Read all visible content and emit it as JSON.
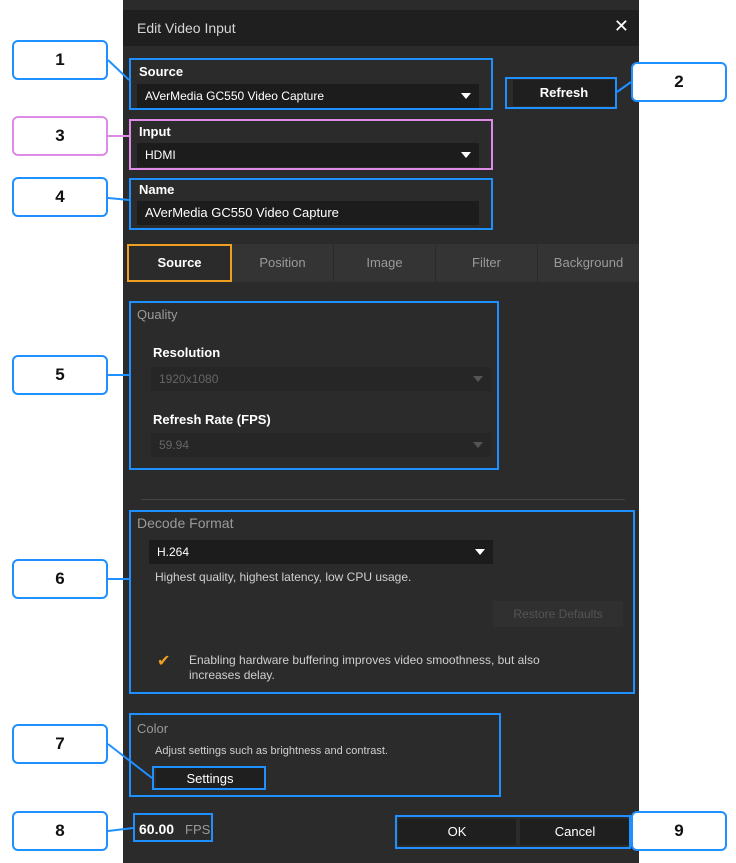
{
  "dialog": {
    "title": "Edit Video Input",
    "close_icon": "✕"
  },
  "source": {
    "label": "Source",
    "value": "AVerMedia GC550 Video Capture"
  },
  "refresh_label": "Refresh",
  "input": {
    "label": "Input",
    "value": "HDMI"
  },
  "name": {
    "label": "Name",
    "value": "AVerMedia GC550 Video Capture"
  },
  "tabs": [
    "Source",
    "Position",
    "Image",
    "Filter",
    "Background"
  ],
  "quality": {
    "header": "Quality",
    "resolution_label": "Resolution",
    "resolution_value": "1920x1080",
    "refresh_rate_label": "Refresh Rate (FPS)",
    "refresh_rate_value": "59.94"
  },
  "decode": {
    "header": "Decode Format",
    "value": "H.264",
    "description": "Highest quality, highest latency, low CPU usage.",
    "restore_label": "Restore Defaults",
    "hw_buffer_text": "Enabling hardware buffering improves video smoothness, but also increases delay.",
    "hw_buffer_checked": true
  },
  "color": {
    "header": "Color",
    "description": "Adjust settings such as brightness and contrast.",
    "settings_label": "Settings"
  },
  "fps": {
    "value": "60.00",
    "unit": "FPS"
  },
  "footer": {
    "ok_label": "OK",
    "cancel_label": "Cancel"
  },
  "callouts": [
    "1",
    "2",
    "3",
    "4",
    "5",
    "6",
    "7",
    "8",
    "9"
  ],
  "colors": {
    "highlight": "#1e90ff",
    "highlight_pink": "#e08ae8",
    "accent": "#f0a020",
    "background": "#2b2b2b"
  }
}
